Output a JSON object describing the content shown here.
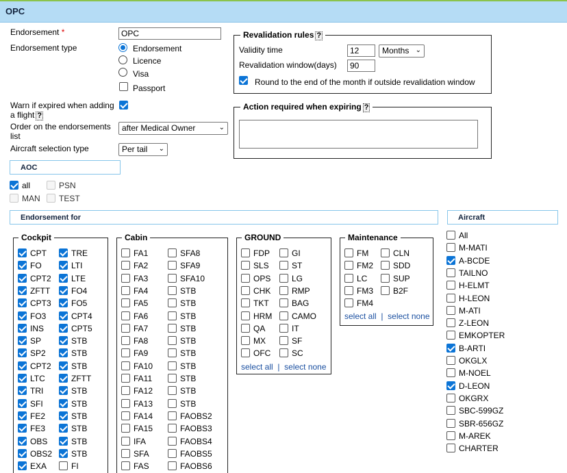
{
  "title": "OPC",
  "form": {
    "endorsement_label": "Endorsement",
    "required_mark": "*",
    "endorsement_value": "OPC",
    "type_label": "Endorsement type",
    "types": [
      {
        "label": "Endorsement",
        "selected": true
      },
      {
        "label": "Licence",
        "selected": false
      },
      {
        "label": "Visa",
        "selected": false
      }
    ],
    "passport_label": "Passport",
    "passport_checked": false,
    "warn_label": "Warn if expired when adding a flight",
    "warn_checked": true,
    "help_mark": "?",
    "order_label": "Order on the endorsements list",
    "order_value": "after Medical Owner",
    "aircraft_sel_label": "Aircraft selection type",
    "aircraft_sel_value": "Per tail"
  },
  "revalidation": {
    "legend": "Revalidation rules",
    "validity_label": "Validity time",
    "validity_value": "12",
    "validity_unit": "Months",
    "window_label": "Revalidation window(days)",
    "window_value": "90",
    "round_label": "Round to the end of the month if outside revalidation window",
    "round_checked": true
  },
  "action": {
    "legend": "Action required when expiring",
    "text": ""
  },
  "aoc": {
    "header": "AOC",
    "items": [
      {
        "label": "all",
        "checked": true,
        "disabled": false
      },
      {
        "label": "PSN",
        "checked": false,
        "disabled": true
      },
      {
        "label": "MAN",
        "checked": false,
        "disabled": true
      },
      {
        "label": "TEST",
        "checked": false,
        "disabled": true
      }
    ]
  },
  "endorsement_for": {
    "header": "Endorsement for",
    "cockpit": {
      "legend": "Cockpit",
      "col1": [
        {
          "label": "CPT",
          "checked": true
        },
        {
          "label": "FO",
          "checked": true
        },
        {
          "label": "CPT2",
          "checked": true
        },
        {
          "label": "ZFTT",
          "checked": true
        },
        {
          "label": "CPT3",
          "checked": true
        },
        {
          "label": "FO3",
          "checked": true
        },
        {
          "label": "INS",
          "checked": true
        },
        {
          "label": "SP",
          "checked": true
        },
        {
          "label": "SP2",
          "checked": true
        },
        {
          "label": "CPT2",
          "checked": true
        },
        {
          "label": "LTC",
          "checked": true
        },
        {
          "label": "TRI",
          "checked": true
        },
        {
          "label": "SFI",
          "checked": true
        },
        {
          "label": "FE2",
          "checked": true
        },
        {
          "label": "FE3",
          "checked": true
        },
        {
          "label": "OBS",
          "checked": true
        },
        {
          "label": "OBS2",
          "checked": true
        },
        {
          "label": "EXA",
          "checked": true
        }
      ],
      "col2": [
        {
          "label": "TRE",
          "checked": true
        },
        {
          "label": "LTI",
          "checked": true
        },
        {
          "label": "LTE",
          "checked": true
        },
        {
          "label": "FO4",
          "checked": true
        },
        {
          "label": "FO5",
          "checked": true
        },
        {
          "label": "CPT4",
          "checked": true
        },
        {
          "label": "CPT5",
          "checked": true
        },
        {
          "label": "STB",
          "checked": true
        },
        {
          "label": "STB",
          "checked": true
        },
        {
          "label": "STB",
          "checked": true
        },
        {
          "label": "ZFTT",
          "checked": true
        },
        {
          "label": "STB",
          "checked": true
        },
        {
          "label": "STB",
          "checked": true
        },
        {
          "label": "STB",
          "checked": true
        },
        {
          "label": "STB",
          "checked": true
        },
        {
          "label": "STB",
          "checked": true
        },
        {
          "label": "STB",
          "checked": true
        },
        {
          "label": "FI",
          "checked": false
        }
      ]
    },
    "cabin": {
      "legend": "Cabin",
      "col1": [
        {
          "label": "FA1"
        },
        {
          "label": "FA2"
        },
        {
          "label": "FA3"
        },
        {
          "label": "FA4"
        },
        {
          "label": "FA5"
        },
        {
          "label": "FA6"
        },
        {
          "label": "FA7"
        },
        {
          "label": "FA8"
        },
        {
          "label": "FA9"
        },
        {
          "label": "FA10"
        },
        {
          "label": "FA11"
        },
        {
          "label": "FA12"
        },
        {
          "label": "FA13"
        },
        {
          "label": "FA14"
        },
        {
          "label": "FA15"
        },
        {
          "label": "IFA"
        },
        {
          "label": "SFA"
        },
        {
          "label": "FAS"
        }
      ],
      "col2": [
        {
          "label": "SFA8"
        },
        {
          "label": "SFA9"
        },
        {
          "label": "SFA10"
        },
        {
          "label": "STB"
        },
        {
          "label": "STB"
        },
        {
          "label": "STB"
        },
        {
          "label": "STB"
        },
        {
          "label": "STB"
        },
        {
          "label": "STB"
        },
        {
          "label": "STB"
        },
        {
          "label": "STB"
        },
        {
          "label": "STB"
        },
        {
          "label": "STB"
        },
        {
          "label": "FAOBS2"
        },
        {
          "label": "FAOBS3"
        },
        {
          "label": "FAOBS4"
        },
        {
          "label": "FAOBS5"
        },
        {
          "label": "FAOBS6"
        }
      ]
    },
    "ground": {
      "legend": "GROUND",
      "col1": [
        {
          "label": "FDP"
        },
        {
          "label": "SLS"
        },
        {
          "label": "OPS"
        },
        {
          "label": "CHK"
        },
        {
          "label": "TKT"
        },
        {
          "label": "HRM"
        },
        {
          "label": "QA"
        },
        {
          "label": "MX"
        },
        {
          "label": "OFC"
        }
      ],
      "col2": [
        {
          "label": "GI"
        },
        {
          "label": "ST"
        },
        {
          "label": "LG"
        },
        {
          "label": "RMP"
        },
        {
          "label": "BAG"
        },
        {
          "label": "CAMO"
        },
        {
          "label": "IT"
        },
        {
          "label": "SF"
        },
        {
          "label": "SC"
        }
      ],
      "select_all": "select all",
      "divider": "|",
      "select_none": "select none"
    },
    "maintenance": {
      "legend": "Maintenance",
      "col1": [
        {
          "label": "FM"
        },
        {
          "label": "FM2"
        },
        {
          "label": "LC"
        },
        {
          "label": "FM3"
        },
        {
          "label": "FM4"
        }
      ],
      "col2": [
        {
          "label": "CLN"
        },
        {
          "label": "SDD"
        },
        {
          "label": "SUP"
        },
        {
          "label": "B2F"
        }
      ],
      "select_all": "select all",
      "divider": "|",
      "select_none": "select none"
    }
  },
  "aircraft": {
    "header": "Aircraft",
    "items": [
      {
        "label": "All",
        "checked": false
      },
      {
        "label": "M-MATI",
        "checked": false
      },
      {
        "label": "A-BCDE",
        "checked": true
      },
      {
        "label": "TAILNO",
        "checked": false
      },
      {
        "label": "H-ELMT",
        "checked": false
      },
      {
        "label": "H-LEON",
        "checked": false
      },
      {
        "label": "M-ATI",
        "checked": false
      },
      {
        "label": "Z-LEON",
        "checked": false
      },
      {
        "label": "EMKOPTER",
        "checked": false
      },
      {
        "label": "B-ARTI",
        "checked": true
      },
      {
        "label": "OKGLX",
        "checked": false
      },
      {
        "label": "M-NOEL",
        "checked": false
      },
      {
        "label": "D-LEON",
        "checked": true
      },
      {
        "label": "OKGRX",
        "checked": false
      },
      {
        "label": "SBC-599GZ",
        "checked": false
      },
      {
        "label": "SBR-656GZ",
        "checked": false
      },
      {
        "label": "M-AREK",
        "checked": false
      },
      {
        "label": "CHARTER",
        "checked": false
      }
    ]
  },
  "colors": {
    "accent": "#0b74d6",
    "titlebar": "#b5dcf5",
    "link": "#1a4fa0"
  }
}
